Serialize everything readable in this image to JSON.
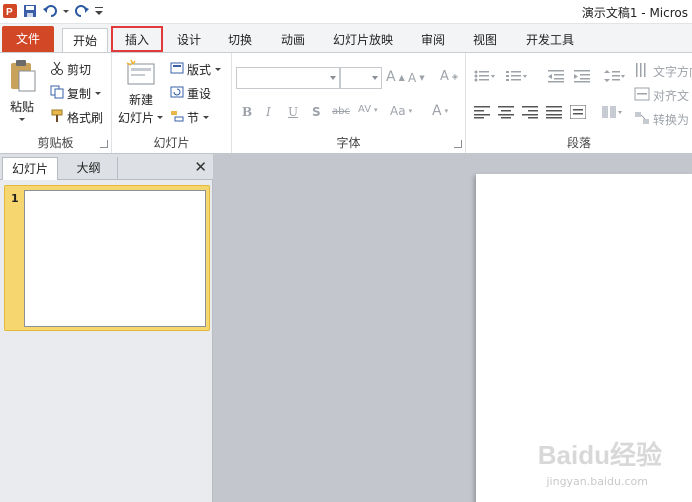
{
  "titlebar": {
    "app_title": "演示文稿1 - Micros"
  },
  "tabs": {
    "file": "文件",
    "home": "开始",
    "insert": "插入",
    "design": "设计",
    "transitions": "切换",
    "animations": "动画",
    "slideshow": "幻灯片放映",
    "review": "审阅",
    "view": "视图",
    "developer": "开发工具"
  },
  "ribbon": {
    "clipboard": {
      "label": "剪贴板",
      "paste": "粘贴",
      "cut": "剪切",
      "copy": "复制",
      "format_painter": "格式刷"
    },
    "slides": {
      "label": "幻灯片",
      "new_slide_line1": "新建",
      "new_slide_line2": "幻灯片",
      "layout": "版式",
      "reset": "重设",
      "section": "节"
    },
    "font": {
      "label": "字体"
    },
    "paragraph": {
      "label": "段落",
      "text_direction": "文字方向",
      "align_text": "对齐文",
      "convert": "转换为"
    }
  },
  "panel": {
    "tab_slides": "幻灯片",
    "tab_outline": "大纲",
    "close": "✕",
    "slide_number": "1"
  },
  "watermark": {
    "main": "Baidu经验",
    "sub": "jingyan.baidu.com"
  },
  "colors": {
    "file_tab": "#d24726",
    "highlight": "#e23a3a",
    "thumb_selected": "#f6d66e"
  }
}
